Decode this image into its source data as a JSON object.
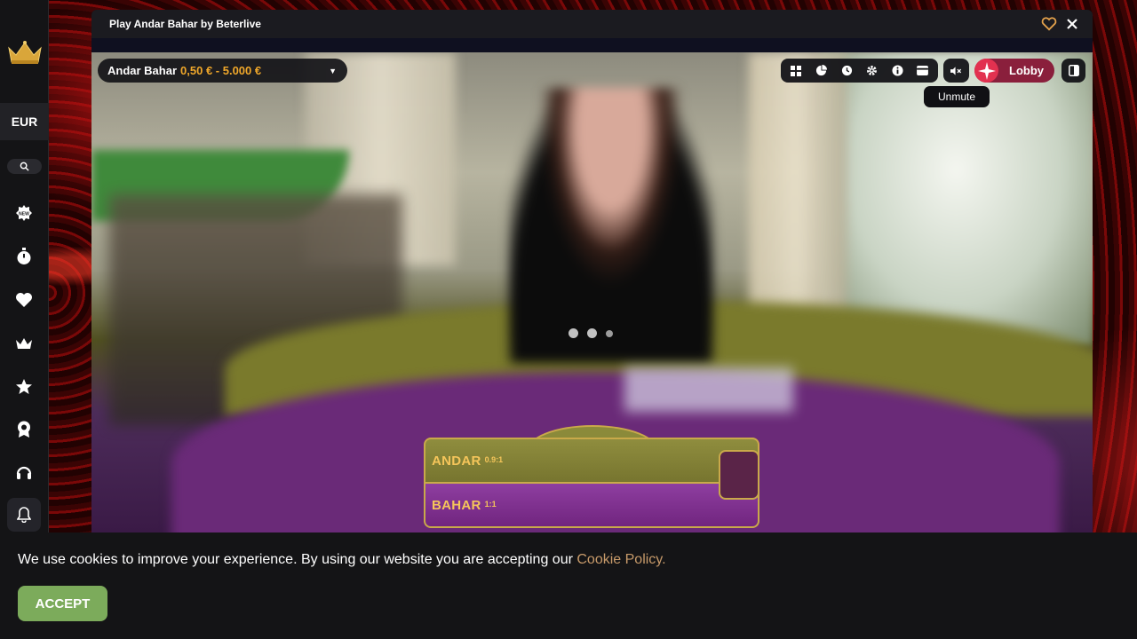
{
  "sidebar": {
    "currency": "EUR",
    "icons": [
      "crown-logo-icon",
      "search-icon",
      "new-icon",
      "stopwatch-icon",
      "heart-icon",
      "crown-icon",
      "star-icon",
      "award-icon",
      "headset-icon",
      "bell-icon"
    ]
  },
  "window": {
    "title": "Play Andar Bahar by Beterlive"
  },
  "game": {
    "name": "Andar Bahar",
    "limits": "0,50 € - 5.000 €",
    "tooltip": "Unmute",
    "lobby_label": "Lobby",
    "andar_label": "ANDAR",
    "andar_odds": "0.9:1",
    "bahar_label": "BAHAR",
    "bahar_odds": "1:1",
    "toolbar_icons": [
      "grid-icon",
      "stats-icon",
      "history-icon",
      "settings-icon",
      "info-icon",
      "wallet-icon"
    ]
  },
  "cookie": {
    "text": "We use cookies to improve your experience. By using our website you are accepting our ",
    "link": "Cookie Policy.",
    "accept": "ACCEPT"
  },
  "colors": {
    "accent_orange": "#f0a82a",
    "lobby": "#8a1f3c",
    "accept": "#7cab5b",
    "cookie_link": "#c79a6a"
  }
}
